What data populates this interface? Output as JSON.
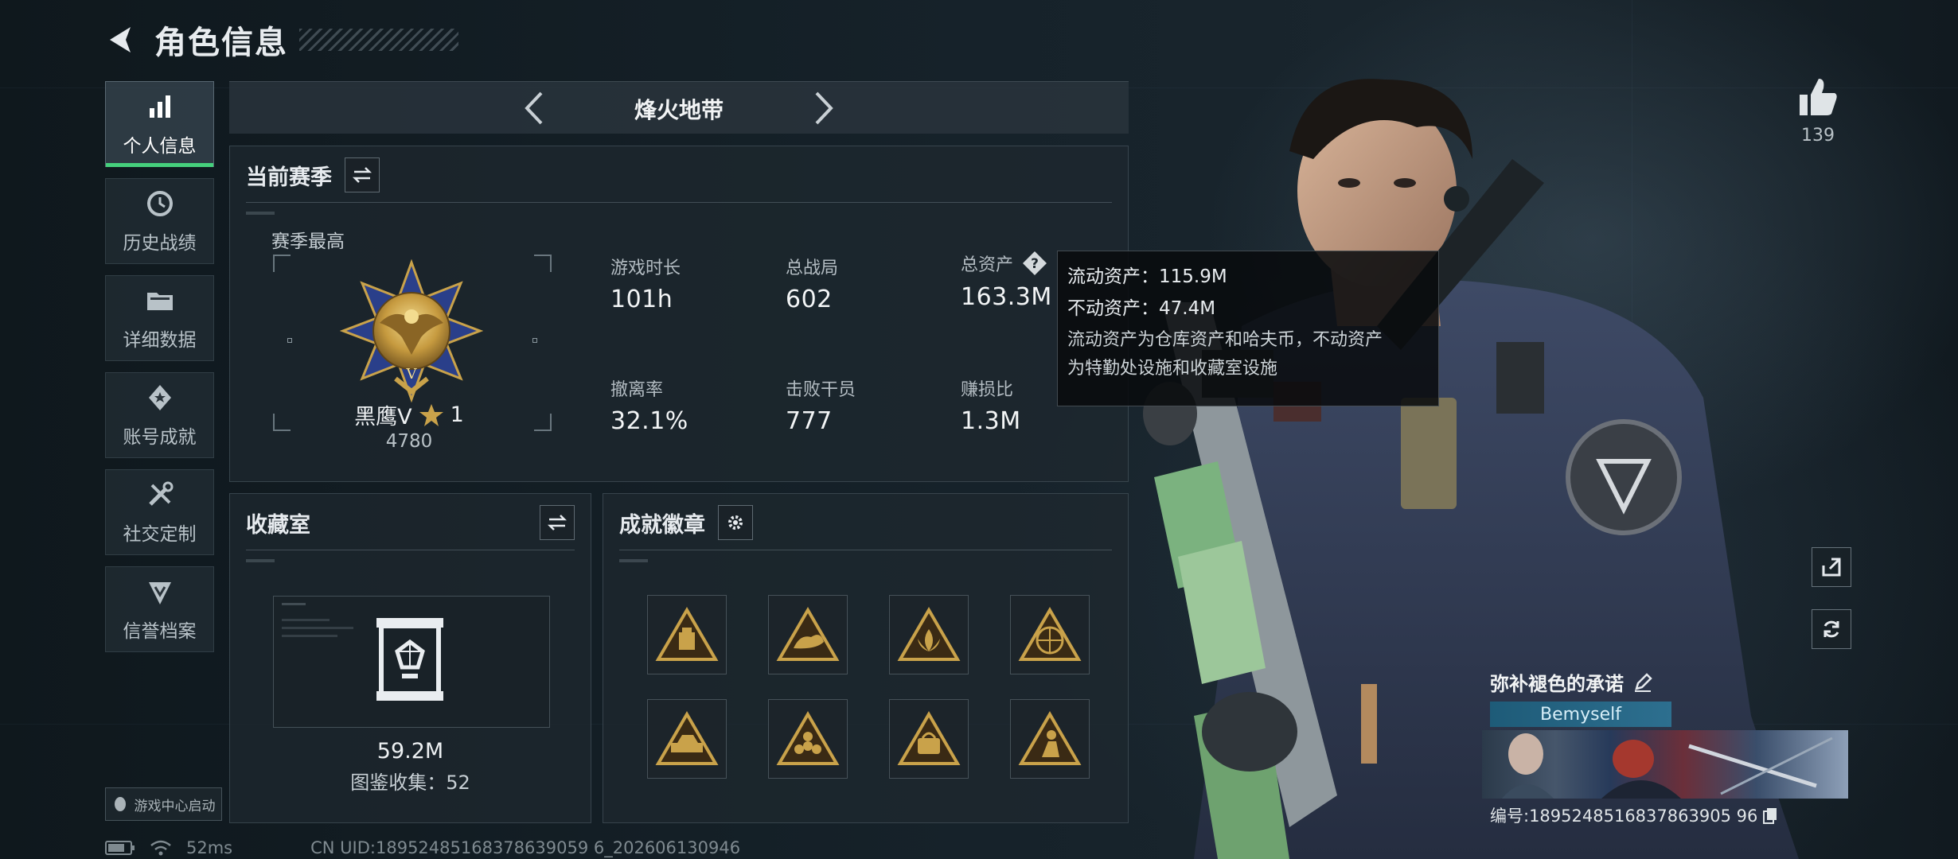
{
  "header": {
    "title": "角色信息"
  },
  "sidebar": {
    "items": [
      {
        "label": "个人信息",
        "icon": "bar-chart-icon",
        "active": true
      },
      {
        "label": "历史战绩",
        "icon": "history-icon",
        "active": false
      },
      {
        "label": "详细数据",
        "icon": "folder-icon",
        "active": false
      },
      {
        "label": "账号成就",
        "icon": "achievement-icon",
        "active": false
      },
      {
        "label": "社交定制",
        "icon": "tools-icon",
        "active": false
      },
      {
        "label": "信誉档案",
        "icon": "credit-icon",
        "active": false
      }
    ],
    "launch_badge": "游戏中心启动"
  },
  "mode": {
    "title": "烽火地带"
  },
  "season": {
    "title": "当前赛季",
    "best_label": "赛季最高",
    "rank_name": "黑鹰V",
    "rank_stars": "1",
    "rank_score": "4780",
    "stats": [
      {
        "label": "游戏时长",
        "value": "101h"
      },
      {
        "label": "总战局",
        "value": "602"
      },
      {
        "label": "总资产",
        "value": "163.3M"
      },
      {
        "label": "撤离率",
        "value": "32.1%"
      },
      {
        "label": "击败干员",
        "value": "777"
      },
      {
        "label": "赚损比",
        "value": "1.3M"
      }
    ]
  },
  "tooltip": {
    "liquid": "流动资产：115.9M",
    "fixed": "不动资产：47.4M",
    "desc1": "流动资产为仓库资产和哈夫币，不动资产",
    "desc2": "为特勤处设施和收藏室设施"
  },
  "collection": {
    "title": "收藏室",
    "value": "59.2M",
    "count": "图鉴收集：52"
  },
  "badges": {
    "title": "成就徽章",
    "count": 8
  },
  "profile": {
    "likes": "139",
    "name": "弥补褪色的承诺",
    "tag": "Bemyself",
    "uid": "编号:1895248516837863905 96"
  },
  "status": {
    "ping": "52ms",
    "uid_line": "CN UID:18952485168378639059 6_202606130946"
  },
  "colors": {
    "accent": "#45d07c",
    "gold": "#c9a24a",
    "panel": "#1e282f"
  }
}
